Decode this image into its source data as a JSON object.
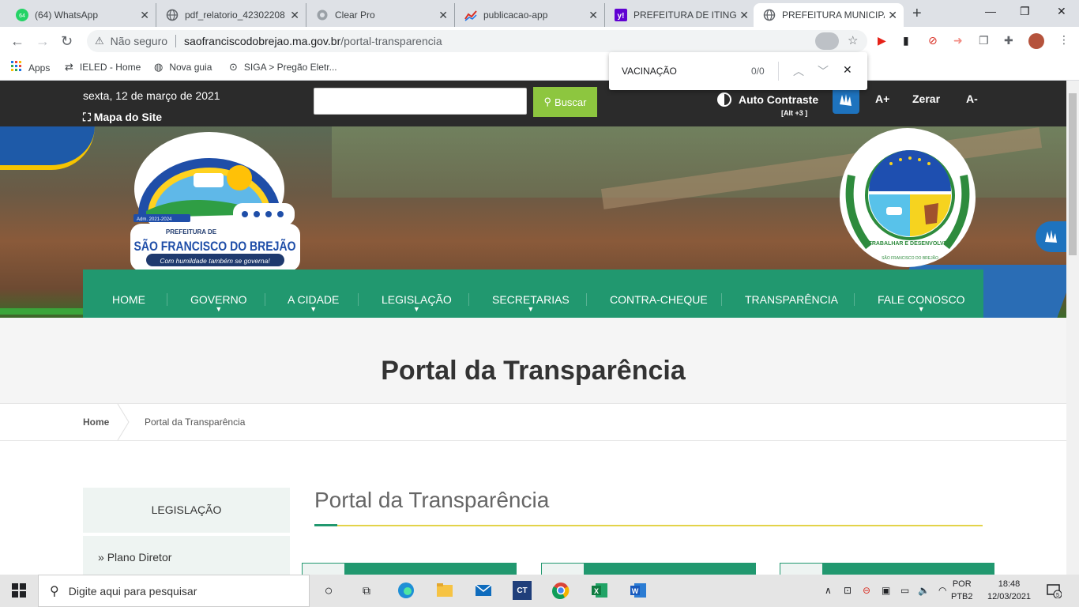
{
  "browser": {
    "tabs": [
      {
        "title": "(64) WhatsApp",
        "favicon": "whatsapp-icon",
        "badge": "64"
      },
      {
        "title": "pdf_relatorio_42302208",
        "favicon": "globe-icon"
      },
      {
        "title": "Clear Pro",
        "favicon": "clear-icon"
      },
      {
        "title": "publicacao-app",
        "favicon": "chart-icon"
      },
      {
        "title": "PREFEITURA DE ITINGA",
        "favicon": "yahoo-icon",
        "favicon_text": "y!"
      },
      {
        "title": "PREFEITURA MUNICIPA",
        "favicon": "globe-icon"
      }
    ],
    "address": {
      "security_label": "Não seguro",
      "url_host": "saofranciscodobrejao.ma.gov.br",
      "url_path": "/portal-transparencia"
    },
    "bookmarks": [
      {
        "label": "Apps",
        "icon": "apps-grid-icon"
      },
      {
        "label": "IELED - Home",
        "icon": "ieled-icon"
      },
      {
        "label": "Nova guia",
        "icon": "globe-icon"
      },
      {
        "label": "SIGA > Pregão Eletr...",
        "icon": "siga-icon"
      }
    ],
    "find": {
      "query": "VACINAÇÃO",
      "count": "0/0"
    }
  },
  "site": {
    "date": "sexta, 12 de março de 2021",
    "sitemap_label": "Mapa do Site",
    "search_button_label": "Buscar",
    "search_value": "",
    "contrast_label": "Auto Contraste",
    "contrast_hint": "[Alt +3 ]",
    "font_increase": "A+",
    "font_reset": "Zerar",
    "font_decrease": "A-",
    "logo_left": {
      "prefix": "PREFEITURA DE",
      "name": "SÃO FRANCISCO DO BREJÃO",
      "slogan": "Com humildade também se governa!",
      "term": "Adm. 2021-2024"
    },
    "logo_right": {
      "motto": "TRABALHAR E DESENVOLVER",
      "name": "SÃO FRANCISCO DO BREJÃO"
    },
    "nav": [
      {
        "label": "HOME",
        "dropdown": false
      },
      {
        "label": "GOVERNO",
        "dropdown": true
      },
      {
        "label": "A CIDADE",
        "dropdown": true
      },
      {
        "label": "LEGISLAÇÃO",
        "dropdown": true
      },
      {
        "label": "SECRETARIAS",
        "dropdown": true
      },
      {
        "label": "CONTRA-CHEQUE",
        "dropdown": false
      },
      {
        "label": "TRANSPARÊNCIA",
        "dropdown": false
      },
      {
        "label": "FALE CONOSCO",
        "dropdown": true
      }
    ],
    "page_title": "Portal da Transparência",
    "breadcrumb": {
      "home": "Home",
      "current": "Portal da Transparência"
    },
    "sidebar": {
      "title": "LEGISLAÇÃO",
      "items": [
        {
          "label": "Plano Diretor"
        }
      ]
    },
    "content_title": "Portal da Transparência",
    "colors": {
      "brand_green": "#21986f",
      "accent_lime": "#8dc63f",
      "dark_strip": "#2b2b2b",
      "rule_yellow": "#e3d34a"
    }
  },
  "taskbar": {
    "search_placeholder": "Digite aqui para pesquisar",
    "language": "POR",
    "layout": "PTB2",
    "time": "18:48",
    "date": "12/03/2021",
    "notification_count": "5"
  }
}
